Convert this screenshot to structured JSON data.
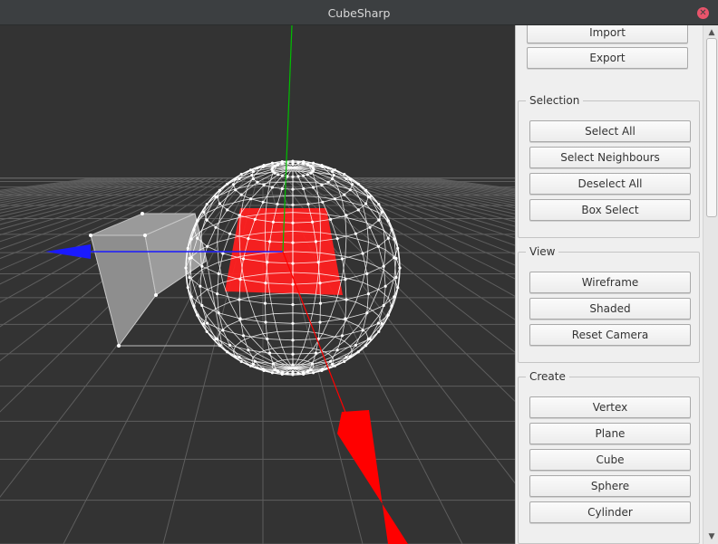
{
  "window": {
    "title": "CubeSharp"
  },
  "panel": {
    "file_buttons": {
      "import": "Import",
      "export": "Export"
    },
    "selection": {
      "title": "Selection",
      "select_all": "Select All",
      "select_neighbours": "Select Neighbours",
      "deselect_all": "Deselect All",
      "box_select": "Box Select"
    },
    "view": {
      "title": "View",
      "wireframe": "Wireframe",
      "shaded": "Shaded",
      "reset_camera": "Reset Camera"
    },
    "create": {
      "title": "Create",
      "vertex": "Vertex",
      "plane": "Plane",
      "cube": "Cube",
      "sphere": "Sphere",
      "cylinder": "Cylinder"
    }
  },
  "colors": {
    "viewport_bg": "#333333",
    "grid": "#5a5a5a",
    "axis_x": "#ff0000",
    "axis_y": "#00c000",
    "axis_z": "#0000ff",
    "selection": "#ff0000",
    "wire": "#ffffff",
    "cube_face": "#8c8c8c"
  }
}
